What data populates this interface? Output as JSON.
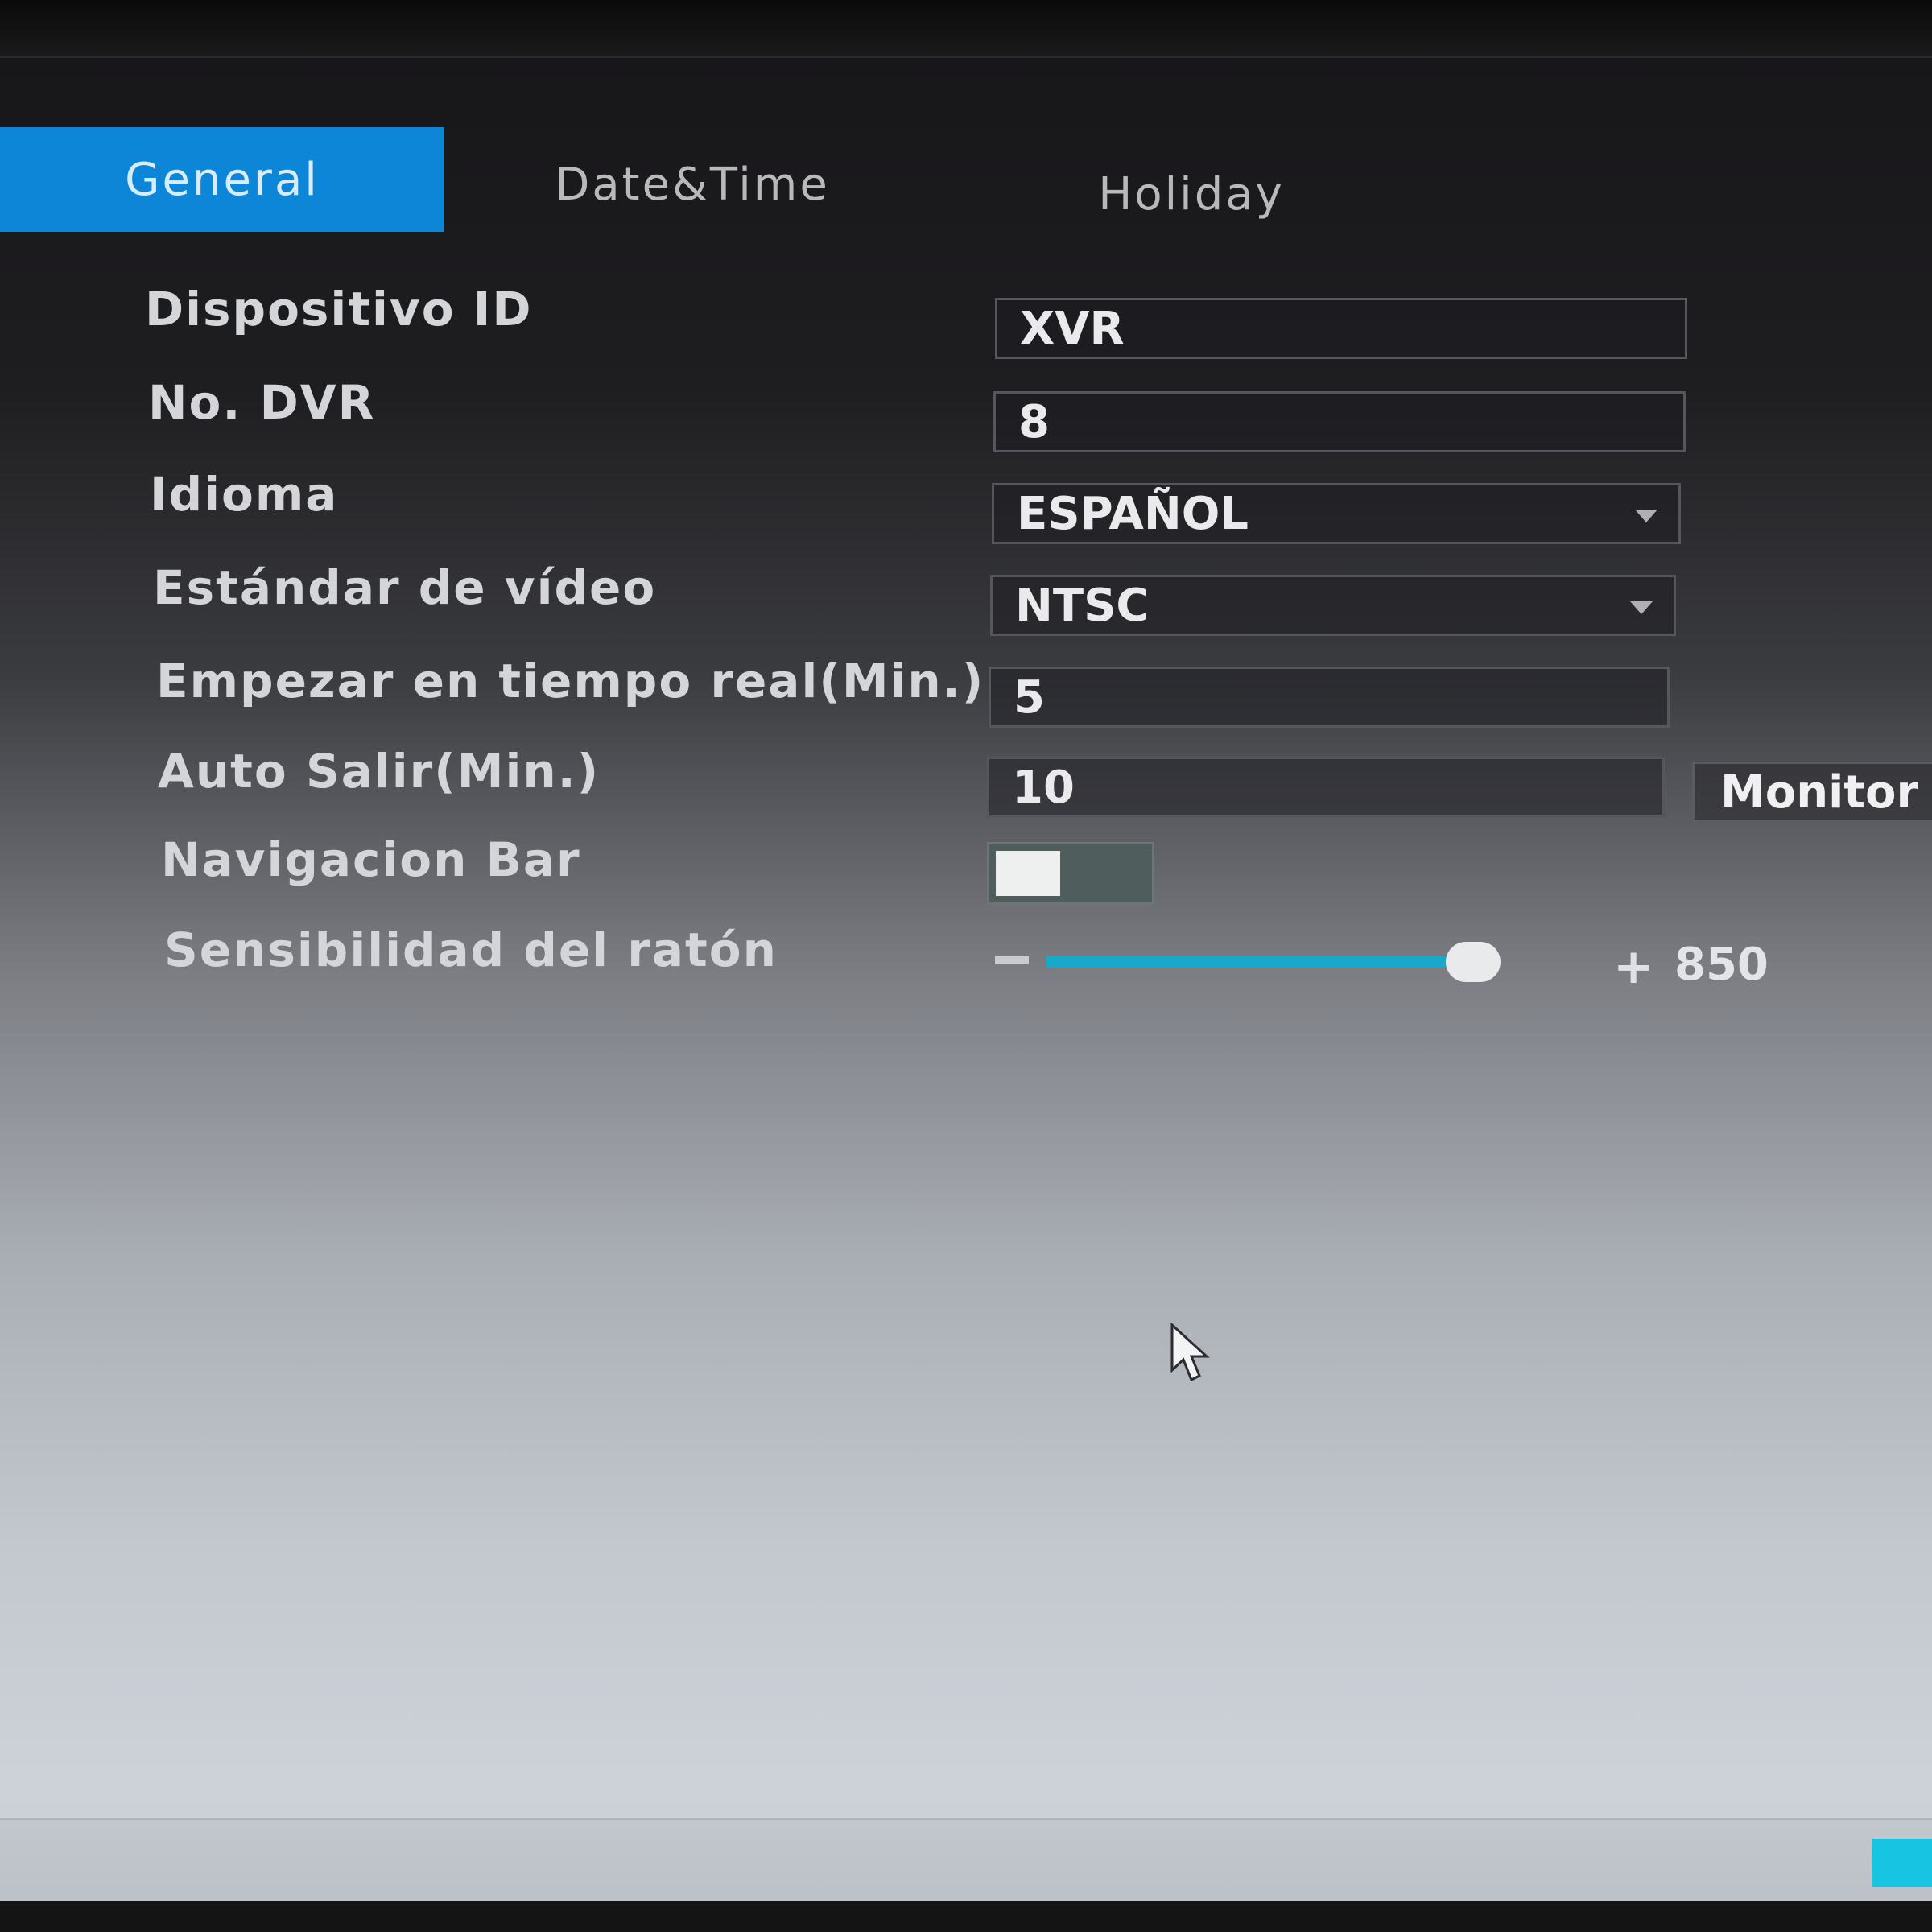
{
  "tabs": [
    {
      "label": "General",
      "active": true
    },
    {
      "label": "Date&Time",
      "active": false
    },
    {
      "label": "Holiday",
      "active": false
    }
  ],
  "settings": {
    "device_id": {
      "label": "Dispositivo ID",
      "value": "XVR"
    },
    "dvr_no": {
      "label": "No. DVR",
      "value": "8"
    },
    "language": {
      "label": "Idioma",
      "value": "ESPAÑOL"
    },
    "video_standard": {
      "label": "Estándar de vídeo",
      "value": "NTSC"
    },
    "realtime_start": {
      "label": "Empezar en tiempo real(Min.)",
      "value": "5"
    },
    "auto_logout": {
      "label": "Auto Salir(Min.)",
      "value": "10",
      "button": "Monitor c"
    },
    "navigation_bar": {
      "label": "Navigacion Bar",
      "enabled": false
    },
    "mouse_sensitivity": {
      "label": "Sensibilidad del ratón",
      "minus": "−",
      "plus": "+",
      "value": "850"
    }
  },
  "colors": {
    "accent": "#0d86d8",
    "slider": "#16a9c9",
    "bottom_accent": "#17c4e2"
  }
}
